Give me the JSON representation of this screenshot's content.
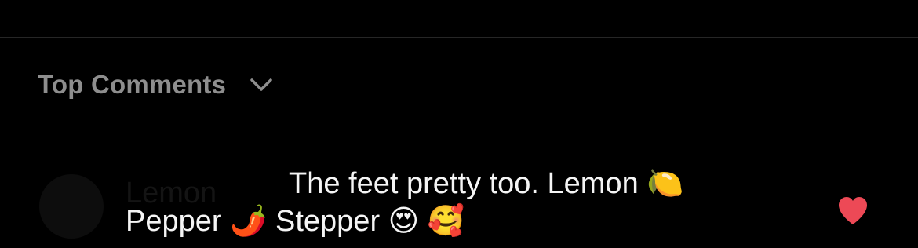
{
  "sort": {
    "label": "Top Comments",
    "chevron_icon": "chevron-down-icon"
  },
  "comment": {
    "username": "Lemon",
    "line1": "The feet pretty too. Lemon",
    "line1_emoji": "🍋",
    "line2_a": "Pepper",
    "line2_emoji1": "🌶️",
    "line2_b": "Stepper",
    "line2_emoji2": "😍",
    "line2_emoji3": "🥰",
    "like_icon": "heart-icon",
    "like_color": "#ed4956",
    "liked": true
  },
  "colors": {
    "background": "#000000",
    "text_primary": "#f5f5f5",
    "text_secondary": "#8e8e8e",
    "divider": "#262626",
    "like": "#ed4956"
  }
}
